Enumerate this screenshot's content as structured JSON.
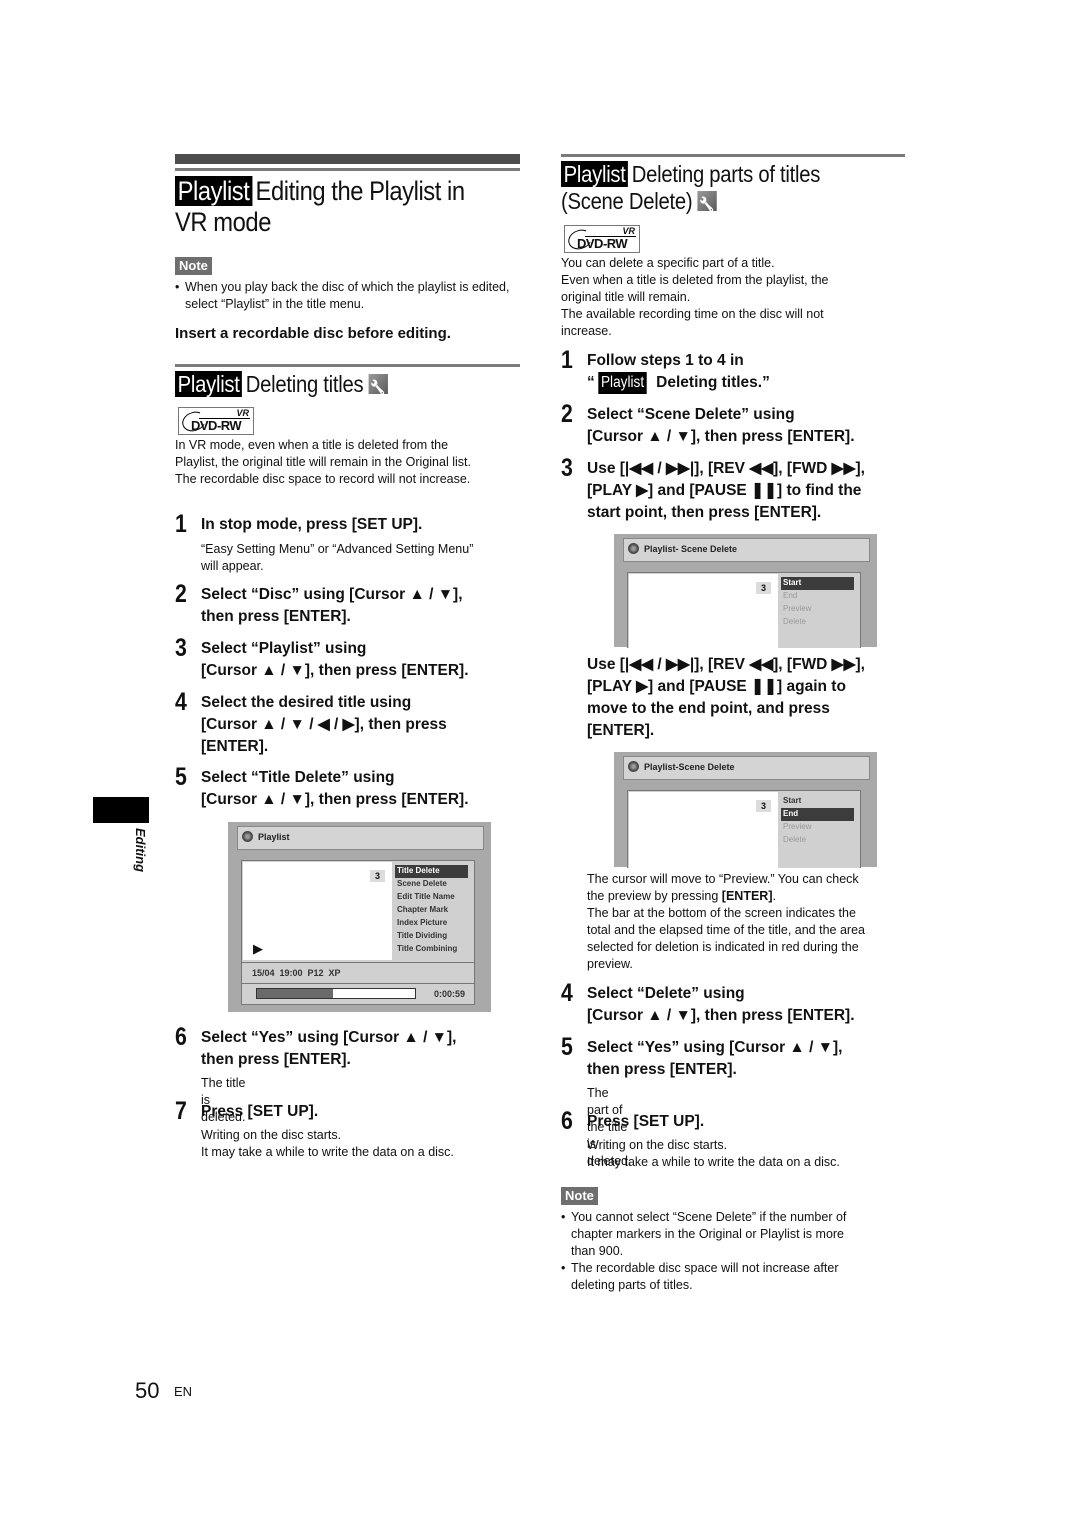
{
  "left": {
    "title_tag": "Playlist",
    "title_line1": "Editing the Playlist in",
    "title_line2": "VR mode",
    "note_label": "Note",
    "note_bullet": "When you play back the disc of which the playlist is edited, select “Playlist” in the title menu.",
    "insert_instruction": "Insert a recordable disc before editing.",
    "section_tag": "Playlist",
    "section_title": "Deleting titles",
    "disc_logo": {
      "format": "DVD-RW",
      "mode": "VR"
    },
    "intro": [
      "In VR mode, even when a title is deleted from the",
      "Playlist, the original title will remain in the Original list.",
      "The recordable disc space to record will not increase."
    ],
    "steps": [
      {
        "num": "1",
        "lines": [
          "In stop mode, press [SET UP]."
        ],
        "sub": [
          "“Easy Setting Menu” or “Advanced Setting Menu”",
          "will appear."
        ]
      },
      {
        "num": "2",
        "lines": [
          "Select “Disc” using [Cursor ▲ / ▼],",
          "then press [ENTER]."
        ]
      },
      {
        "num": "3",
        "lines": [
          "Select “Playlist” using",
          "[Cursor ▲ / ▼], then press [ENTER]."
        ]
      },
      {
        "num": "4",
        "lines": [
          "Select the desired title using",
          "[Cursor ▲ / ▼ / ◀ / ▶], then press",
          "[ENTER]."
        ]
      },
      {
        "num": "5",
        "lines": [
          "Select “Title Delete” using",
          "[Cursor ▲ / ▼], then press [ENTER]."
        ]
      },
      {
        "num": "6",
        "lines": [
          "Select “Yes” using [Cursor ▲ / ▼],",
          "then press [ENTER]."
        ],
        "sub": [
          "The title is deleted."
        ]
      },
      {
        "num": "7",
        "lines": [
          "Press [SET UP]."
        ],
        "sub": [
          "Writing on the disc starts.",
          "It may take a while to write the data on a disc."
        ]
      }
    ],
    "osd": {
      "header": "Playlist",
      "title_number": "3",
      "menu": [
        "Title Delete",
        "Scene Delete",
        "Edit Title Name",
        "Chapter Mark",
        "Index Picture",
        "Title Dividing",
        "Title Combining"
      ],
      "selected_index": 0,
      "play_symbol": "▶",
      "status": "15/04  19:00  P12  XP",
      "elapsed": "0:00:59",
      "progress_fraction": 0.48
    }
  },
  "right": {
    "title_tag": "Playlist",
    "title_line1": "Deleting parts of titles",
    "title_line2": "(Scene Delete)",
    "disc_logo": {
      "format": "DVD-RW",
      "mode": "VR"
    },
    "intro": [
      "You can delete a specific part of a title.",
      "Even when a title is deleted from the playlist, the",
      "original title will remain.",
      "The available recording time on the disc will not",
      "increase."
    ],
    "step1": {
      "num": "1",
      "line1": "Follow steps 1 to 4 in",
      "quote_open": "“",
      "tag": "Playlist",
      "line2_rest": "Deleting titles.”"
    },
    "step2": {
      "num": "2",
      "lines": [
        "Select “Scene Delete” using",
        "[Cursor ▲ / ▼], then press [ENTER]."
      ]
    },
    "step3": {
      "num": "3",
      "lines": [
        "Use [|◀◀ / ▶▶|], [REV ◀◀], [FWD ▶▶],",
        "[PLAY ▶] and [PAUSE ❚❚] to find the",
        "start point, then press [ENTER]."
      ]
    },
    "osd1": {
      "header": "Playlist- Scene Delete",
      "title_number": "3",
      "menu": [
        "Start",
        "End",
        "Preview",
        "Delete"
      ],
      "selected_index": 0
    },
    "step3b": {
      "lines": [
        "Use [|◀◀ / ▶▶|], [REV ◀◀], [FWD ▶▶],",
        "[PLAY ▶] and [PAUSE ❚❚] again to",
        "move to the end point, and press",
        "[ENTER]."
      ]
    },
    "osd2": {
      "header": "Playlist-Scene Delete",
      "title_number": "3",
      "menu": [
        "Start",
        "End",
        "Preview",
        "Delete"
      ],
      "selected_index": 1
    },
    "cursor_note": {
      "line1": "The cursor will move to “Preview.” You can check",
      "line2_pre": "the preview by pressing ",
      "line2_bold": "[ENTER]",
      "line2_post": ".",
      "rest": [
        "The bar at the bottom of the screen indicates the",
        "total and the elapsed time of the title, and the area",
        "selected for deletion is indicated in red during the",
        "preview."
      ]
    },
    "steps_after": [
      {
        "num": "4",
        "lines": [
          "Select “Delete” using",
          "[Cursor ▲ / ▼], then press [ENTER]."
        ]
      },
      {
        "num": "5",
        "lines": [
          "Select “Yes” using [Cursor ▲ / ▼],",
          "then press [ENTER]."
        ],
        "sub": [
          "The part of the title is deleted."
        ]
      },
      {
        "num": "6",
        "lines": [
          "Press [SET UP]."
        ],
        "sub": [
          "Writing on the disc starts.",
          "It may take a while to write the data on a disc."
        ]
      }
    ],
    "note_label": "Note",
    "notes": [
      [
        "You cannot select “Scene Delete” if the number of",
        "chapter markers in the Original or Playlist is more",
        "than 900."
      ],
      [
        "The recordable disc space will not increase after",
        "deleting parts of titles."
      ]
    ]
  },
  "side_tab": "Editing",
  "footer": {
    "page_number": "50",
    "language": "EN"
  }
}
